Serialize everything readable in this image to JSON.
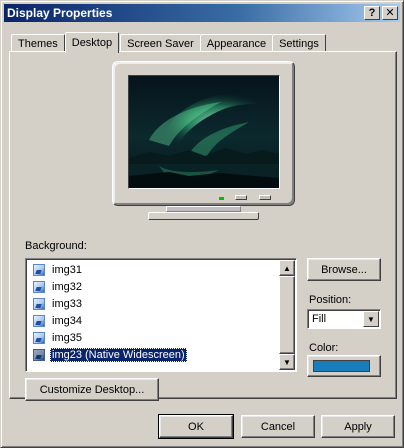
{
  "window": {
    "title": "Display Properties",
    "help_label": "?",
    "close_label": "✕"
  },
  "tabs": [
    {
      "label": "Themes"
    },
    {
      "label": "Desktop"
    },
    {
      "label": "Screen Saver"
    },
    {
      "label": "Appearance"
    },
    {
      "label": "Settings"
    }
  ],
  "active_tab": "Desktop",
  "background": {
    "label": "Background:",
    "items": [
      {
        "label": "img31"
      },
      {
        "label": "img32"
      },
      {
        "label": "img33"
      },
      {
        "label": "img34"
      },
      {
        "label": "img35"
      },
      {
        "label": "img23 (Native Widescreen)"
      }
    ],
    "selected_index": 5,
    "scroll_up": "▲",
    "scroll_down": "▼"
  },
  "browse_label": "Browse...",
  "position": {
    "label": "Position:",
    "value": "Fill",
    "arrow": "▼"
  },
  "color": {
    "label": "Color:",
    "value": "#1a7dbb"
  },
  "customize_label": "Customize Desktop...",
  "footer": {
    "ok_label": "OK",
    "cancel_label": "Cancel",
    "apply_label": "Apply"
  },
  "colors": {
    "title_bar": "#0a246a",
    "face": "#d4d0c8",
    "selection": "#0a246a"
  }
}
